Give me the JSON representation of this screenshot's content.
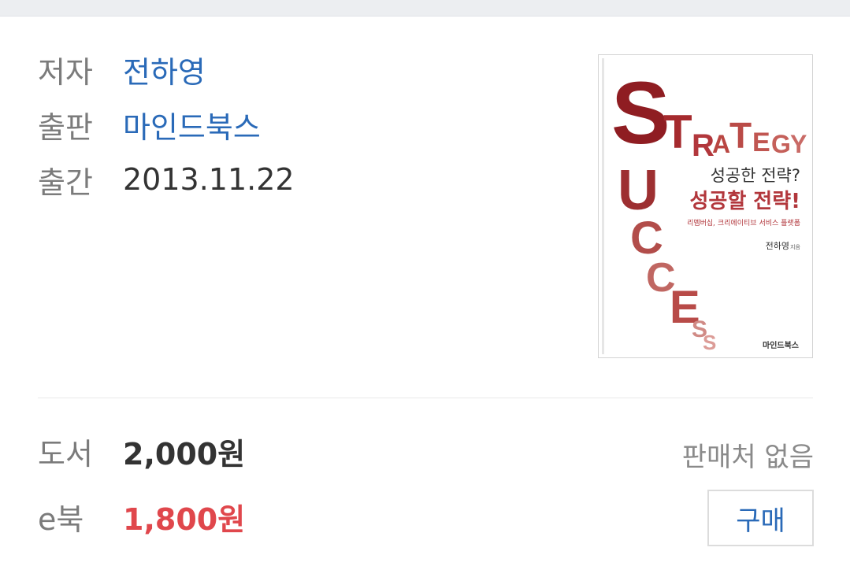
{
  "book": {
    "author_label": "저자",
    "author": "전하영",
    "publisher_label": "출판",
    "publisher": "마인드북스",
    "pubdate_label": "출간",
    "pubdate": "2013.11.22"
  },
  "cover": {
    "title_en_1": "STRATEGY",
    "title_en_2": "SUCCESS",
    "title_ko_1": "성공한 전략?",
    "title_ko_2": "성공할 전략!",
    "subtitle": "리멤버십, 크리에이티브 서비스 플랫폼",
    "author": "전하영",
    "author_suffix": "지음",
    "publisher": "마인드북스",
    "colors": {
      "dark_red": "#8f1d22",
      "red": "#b2373c",
      "mid_red": "#c96a66",
      "light_red": "#dc9c97"
    }
  },
  "prices": {
    "book_label": "도서",
    "book_price": "2,000원",
    "ebook_label": "e북",
    "ebook_price": "1,800원",
    "no_seller": "판매처 없음",
    "buy_label": "구매"
  },
  "colors": {
    "link": "#2a6ab8",
    "ebook_price": "#e0474c",
    "label": "#7b7b7b"
  }
}
